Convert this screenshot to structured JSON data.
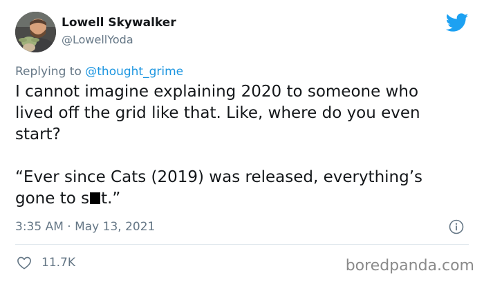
{
  "author": {
    "display_name": "Lowell Skywalker",
    "handle": "@LowellYoda",
    "avatar_icon": "user-avatar-photo"
  },
  "reply": {
    "prefix": "Replying to ",
    "mention": "@thought_grime"
  },
  "tweet": {
    "paragraph_1": "I cannot imagine explaining 2020 to someone who\nlived off the grid like that. Like, where do you even\nstart?",
    "quote_start": "“Ever since Cats (2019) was released, everything’s\ngone to s",
    "quote_end": "t.”"
  },
  "meta": {
    "timestamp": "3:35 AM · May 13, 2021"
  },
  "actions": {
    "like_count": "11.7K"
  },
  "watermark": "boredpanda.com",
  "colors": {
    "twitter_blue": "#1da1f2",
    "mention_blue": "#1b95e0",
    "secondary_text": "#657786",
    "divider": "#e1e8ed"
  },
  "icons": [
    "twitter-bird-icon",
    "info-icon",
    "heart-icon"
  ]
}
